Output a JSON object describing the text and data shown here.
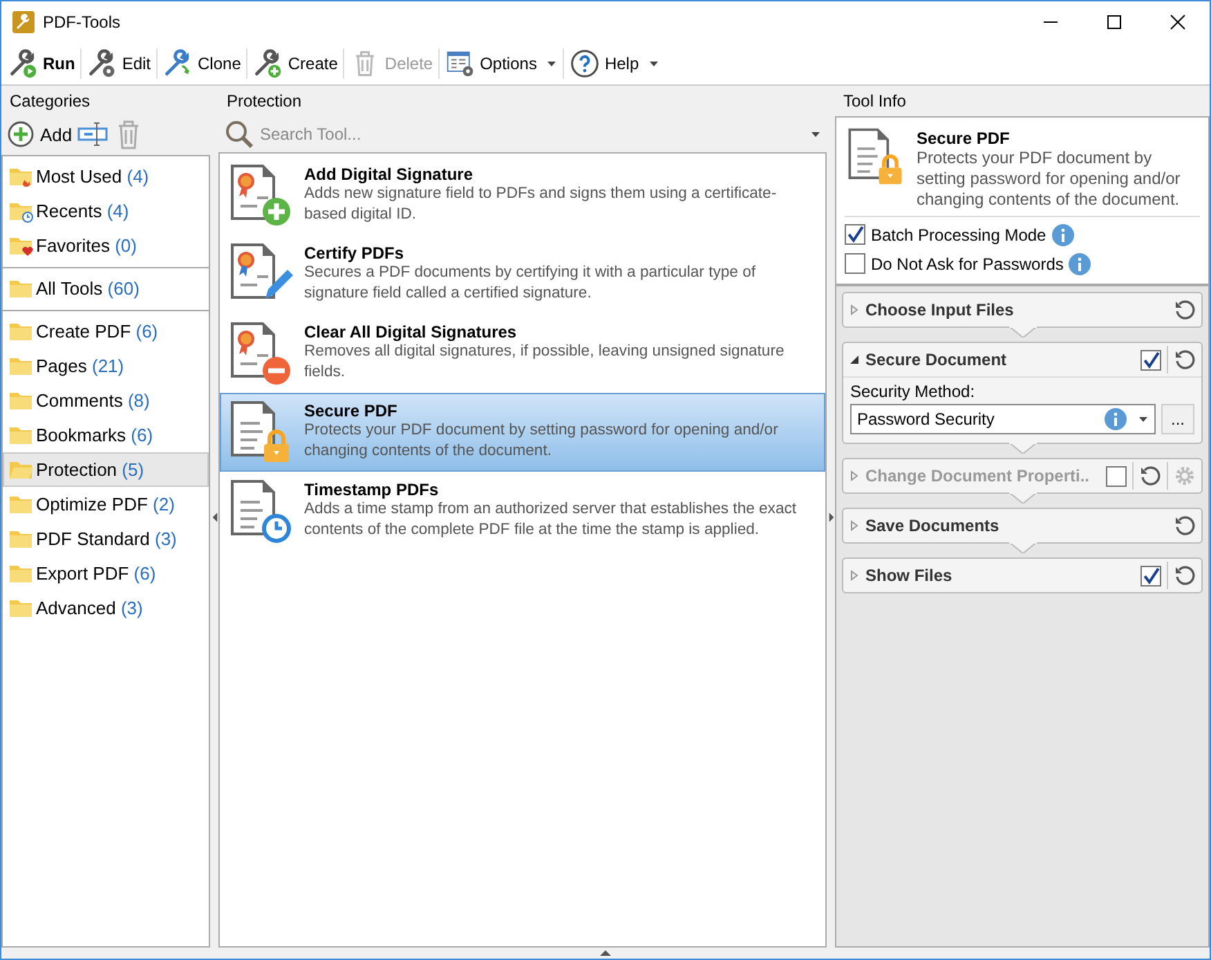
{
  "window": {
    "title": "PDF-Tools"
  },
  "toolbar": [
    {
      "label": "Run",
      "bold": true,
      "disabled": false,
      "dropdown": false
    },
    {
      "label": "Edit",
      "bold": false,
      "disabled": false,
      "dropdown": false
    },
    {
      "label": "Clone",
      "bold": false,
      "disabled": false,
      "dropdown": false
    },
    {
      "label": "Create",
      "bold": false,
      "disabled": false,
      "dropdown": false
    },
    {
      "label": "Delete",
      "bold": false,
      "disabled": true,
      "dropdown": false
    },
    {
      "label": "Options",
      "bold": false,
      "disabled": false,
      "dropdown": true
    },
    {
      "label": "Help",
      "bold": false,
      "disabled": false,
      "dropdown": true
    }
  ],
  "categories": {
    "title": "Categories",
    "add_label": "Add",
    "groups": [
      [
        {
          "name": "Most Used",
          "count": "(4)",
          "selected": false
        },
        {
          "name": "Recents",
          "count": "(4)",
          "selected": false
        },
        {
          "name": "Favorites",
          "count": "(0)",
          "selected": false
        }
      ],
      [
        {
          "name": "All Tools",
          "count": "(60)",
          "selected": false
        }
      ],
      [
        {
          "name": "Create PDF",
          "count": "(6)",
          "selected": false
        },
        {
          "name": "Pages",
          "count": "(21)",
          "selected": false
        },
        {
          "name": "Comments",
          "count": "(8)",
          "selected": false
        },
        {
          "name": "Bookmarks",
          "count": "(6)",
          "selected": false
        },
        {
          "name": "Protection",
          "count": "(5)",
          "selected": true
        },
        {
          "name": "Optimize PDF",
          "count": "(2)",
          "selected": false
        },
        {
          "name": "PDF Standard",
          "count": "(3)",
          "selected": false
        },
        {
          "name": "Export PDF",
          "count": "(6)",
          "selected": false
        },
        {
          "name": "Advanced",
          "count": "(3)",
          "selected": false
        }
      ]
    ]
  },
  "tools": {
    "title": "Protection",
    "search": {
      "placeholder": "Search Tool..."
    },
    "items": [
      {
        "title": "Add Digital Signature",
        "description": "Adds new signature field to PDFs and signs them using a certificate-based digital ID.",
        "selected": false
      },
      {
        "title": "Certify PDFs",
        "description": "Secures a PDF documents by certifying it with a particular type of signature field called a certified signature.",
        "selected": false
      },
      {
        "title": "Clear All Digital Signatures",
        "description": "Removes all digital signatures, if possible, leaving unsigned signature fields.",
        "selected": false
      },
      {
        "title": "Secure PDF",
        "description": "Protects your PDF document by setting password for opening and/or changing contents of the document.",
        "selected": true
      },
      {
        "title": "Timestamp PDFs",
        "description": "Adds a time stamp from an authorized server that establishes the exact contents of the complete PDF file at the time the stamp is applied.",
        "selected": false
      }
    ]
  },
  "tool_info": {
    "title": "Tool Info",
    "name": "Secure PDF",
    "description": "Protects your PDF document by setting password for opening and/or changing contents of the document.",
    "options": [
      {
        "label": "Batch Processing Mode",
        "checked": true
      },
      {
        "label": "Do Not Ask for Passwords",
        "checked": false
      }
    ],
    "steps": [
      {
        "title": "Choose Input Files",
        "expanded": false,
        "disabled": false
      },
      {
        "title": "Secure Document",
        "expanded": true,
        "disabled": false,
        "checked": true,
        "field_label": "Security Method:",
        "value": "Password Security",
        "more_label": "..."
      },
      {
        "title": "Change Document Properti..",
        "expanded": false,
        "disabled": true,
        "checked": false,
        "settings": true
      },
      {
        "title": "Save Documents",
        "expanded": false,
        "disabled": false
      },
      {
        "title": "Show Files",
        "expanded": false,
        "disabled": false,
        "checked": true
      }
    ]
  }
}
